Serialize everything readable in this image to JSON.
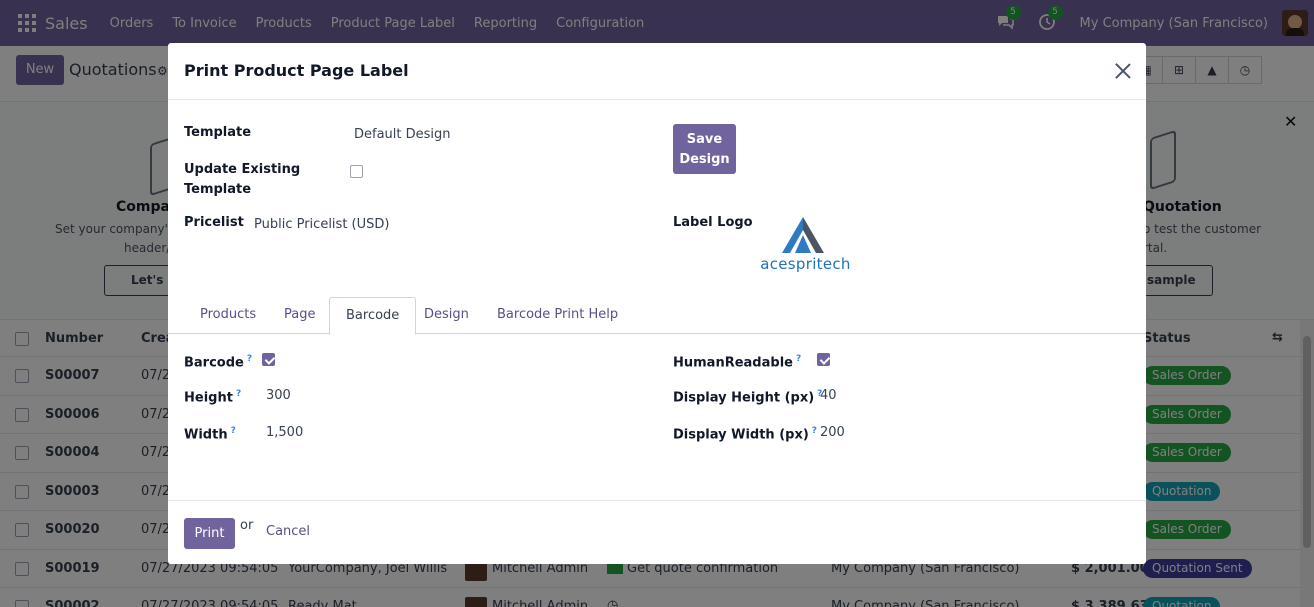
{
  "navbar": {
    "app_name": "Sales",
    "menu": [
      "Orders",
      "To Invoice",
      "Products",
      "Product Page Label",
      "Reporting",
      "Configuration"
    ],
    "chat_badge": "5",
    "activity_badge": "5",
    "company": "My Company (San Francisco)"
  },
  "control": {
    "new_label": "New",
    "breadcrumb": "Quotations"
  },
  "banner": {
    "company_title": "Compan",
    "company_text_1": "Set your company's",
    "company_text_2": "header/",
    "company_button": "Let's s",
    "quotation_title": "Quotation",
    "quotation_text_1": "o test the customer",
    "quotation_text_2": "rtal.",
    "quotation_button": "sample"
  },
  "list": {
    "headers": {
      "number": "Number",
      "creation": "Crea",
      "status": "Status"
    },
    "rows": [
      {
        "number": "S00007",
        "date": "07/2",
        "status": "Sales Order",
        "status_color": "#28a745"
      },
      {
        "number": "S00006",
        "date": "07/2",
        "status": "Sales Order",
        "status_color": "#28a745"
      },
      {
        "number": "S00004",
        "date": "07/2",
        "status": "Sales Order",
        "status_color": "#28a745"
      },
      {
        "number": "S00003",
        "date": "07/2",
        "status": "Quotation",
        "status_color": "#17a2b8"
      },
      {
        "number": "S00020",
        "date": "07/2",
        "status": "Sales Order",
        "status_color": "#28a745"
      },
      {
        "number": "S00019",
        "date": "07/27/2023 09:54:05",
        "customer": "YourCompany, Joel Willis",
        "salesperson": "Mitchell Admin",
        "activity": "Get quote confirmation",
        "company": "My Company (San Francisco)",
        "total": "$ 2,001.00",
        "status": "Quotation Sent",
        "status_color": "#3c3f9c"
      },
      {
        "number": "S00002",
        "date": "07/27/2023 09:54:05",
        "customer": "Ready Mat",
        "salesperson": "Mitchell Admin",
        "activity": "",
        "company": "My Company (San Francisco)",
        "total": "$ 3,389.63",
        "status": "Quotation",
        "status_color": "#17a2b8"
      }
    ]
  },
  "modal": {
    "title": "Print Product Page Label",
    "template_label": "Template",
    "template_value": "Default Design",
    "update_label_1": "Update Existing",
    "update_label_2": "Template",
    "update_checked": false,
    "save_label_1": "Save",
    "save_label_2": "Design",
    "pricelist_label": "Pricelist",
    "pricelist_value": "Public Pricelist (USD)",
    "logo_label": "Label Logo",
    "logo_text": "acespritech",
    "tabs": [
      "Products",
      "Page",
      "Barcode",
      "Design",
      "Barcode Print Help"
    ],
    "active_tab": "Barcode",
    "barcode": {
      "barcode_label": "Barcode",
      "barcode_checked": true,
      "height_label": "Height",
      "height_value": "300",
      "width_label": "Width",
      "width_value": "1,500",
      "human_label": "HumanReadable",
      "human_checked": true,
      "display_height_label": "Display Height (px)",
      "display_height_value": "40",
      "display_width_label": "Display Width (px)",
      "display_width_value": "200",
      "help_mark": "?"
    },
    "print_label": "Print",
    "or_label": "or",
    "cancel_label": "Cancel"
  },
  "colors": {
    "brand": "#71639e",
    "link": "#5b4e86"
  }
}
